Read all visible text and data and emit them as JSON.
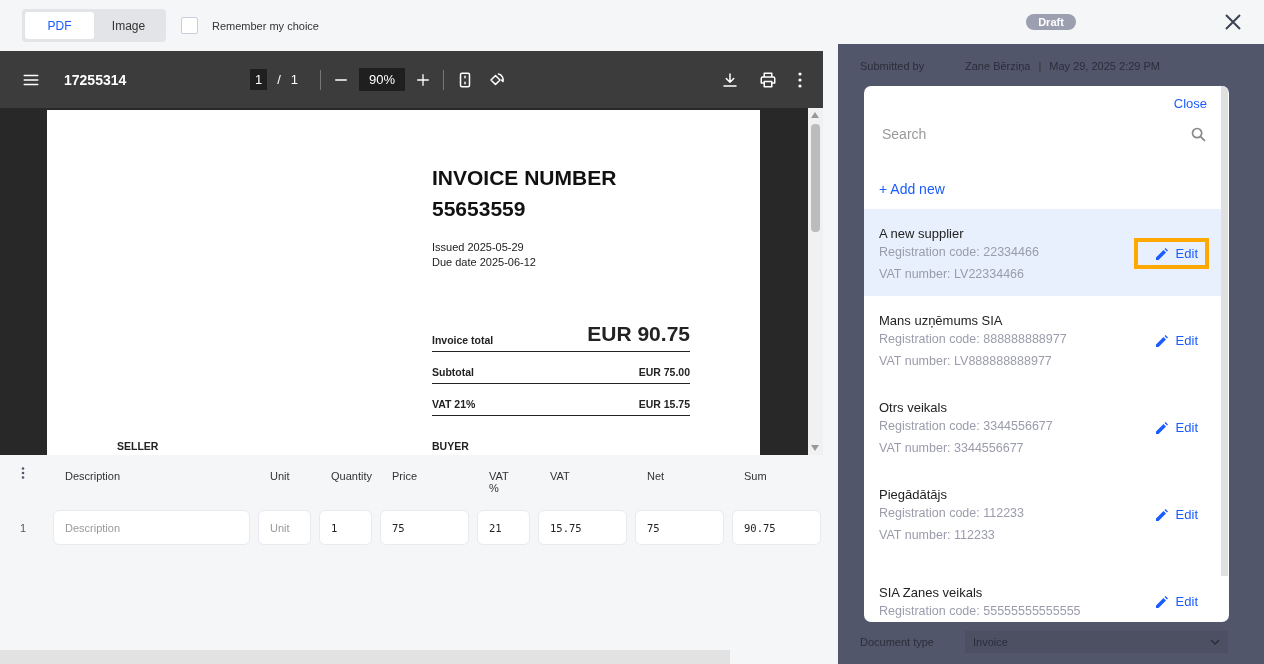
{
  "view_toggle": [
    {
      "label": "PDF",
      "selected": true
    },
    {
      "label": "Image",
      "selected": false
    }
  ],
  "remember_choice": {
    "label": "Remember my choice",
    "checked": false
  },
  "pdf_viewer": {
    "file_name": "17255314",
    "page": "1",
    "separator": "/",
    "page_count": "1",
    "zoom": "90%"
  },
  "invoice": {
    "title": "INVOICE NUMBER",
    "number": "55653559",
    "issued": "Issued 2025-05-29",
    "due": "Due date 2025-06-12",
    "totals": [
      {
        "kind": "grand",
        "label": "Invoice total",
        "value": "EUR 90.75"
      },
      {
        "kind": "line",
        "label": "Subtotal",
        "value": "EUR 75.00"
      },
      {
        "kind": "line",
        "label": "VAT 21%",
        "value": "EUR 15.75"
      }
    ],
    "seller_heading": "SELLER",
    "buyer_heading": "BUYER"
  },
  "line_items": {
    "columns": [
      "Description",
      "Unit",
      "Quantity",
      "Price",
      "VAT %",
      "VAT",
      "Net",
      "Sum"
    ],
    "rows": [
      {
        "number": "1",
        "cells": [
          {
            "placeholder": "Description"
          },
          {
            "placeholder": "Unit"
          },
          {
            "value": "1"
          },
          {
            "value": "75"
          },
          {
            "value": "21"
          },
          {
            "value": "15.75"
          },
          {
            "value": "75"
          },
          {
            "value": "90.75"
          }
        ]
      }
    ]
  },
  "panel": {
    "status": "Draft",
    "submitted_by_label": "Submitted by",
    "submitted_by": "Zane Bērziņa",
    "separator": "|",
    "submitted_at": "May 29, 2025 2:29 PM",
    "document_type_label": "Document type",
    "document_type": "Invoice"
  },
  "supplier_picker": {
    "close": "Close",
    "search_placeholder": "Search",
    "add_new": "+ Add new",
    "suppliers": [
      {
        "name": "A new supplier",
        "registration": "Registration code: 22334466",
        "vat": "VAT number: LV22334466",
        "edit": "Edit",
        "selected": true,
        "highlighted": true
      },
      {
        "name": "Mans uzņēmums SIA",
        "registration": "Registration code: 888888888977",
        "vat": "VAT number: LV888888888977",
        "edit": "Edit",
        "selected": false,
        "highlighted": false
      },
      {
        "name": "Otrs veikals",
        "registration": "Registration code: 3344556677",
        "vat": "VAT number: 3344556677",
        "edit": "Edit",
        "selected": false,
        "highlighted": false
      },
      {
        "name": "Piegādātājs",
        "registration": "Registration code: 112233",
        "vat": "VAT number: 112233",
        "edit": "Edit",
        "selected": false,
        "highlighted": false
      },
      {
        "name": "SIA Zanes veikals",
        "registration": "Registration code: 55555555555555",
        "edit": "Edit",
        "selected": false,
        "highlighted": false
      }
    ]
  }
}
